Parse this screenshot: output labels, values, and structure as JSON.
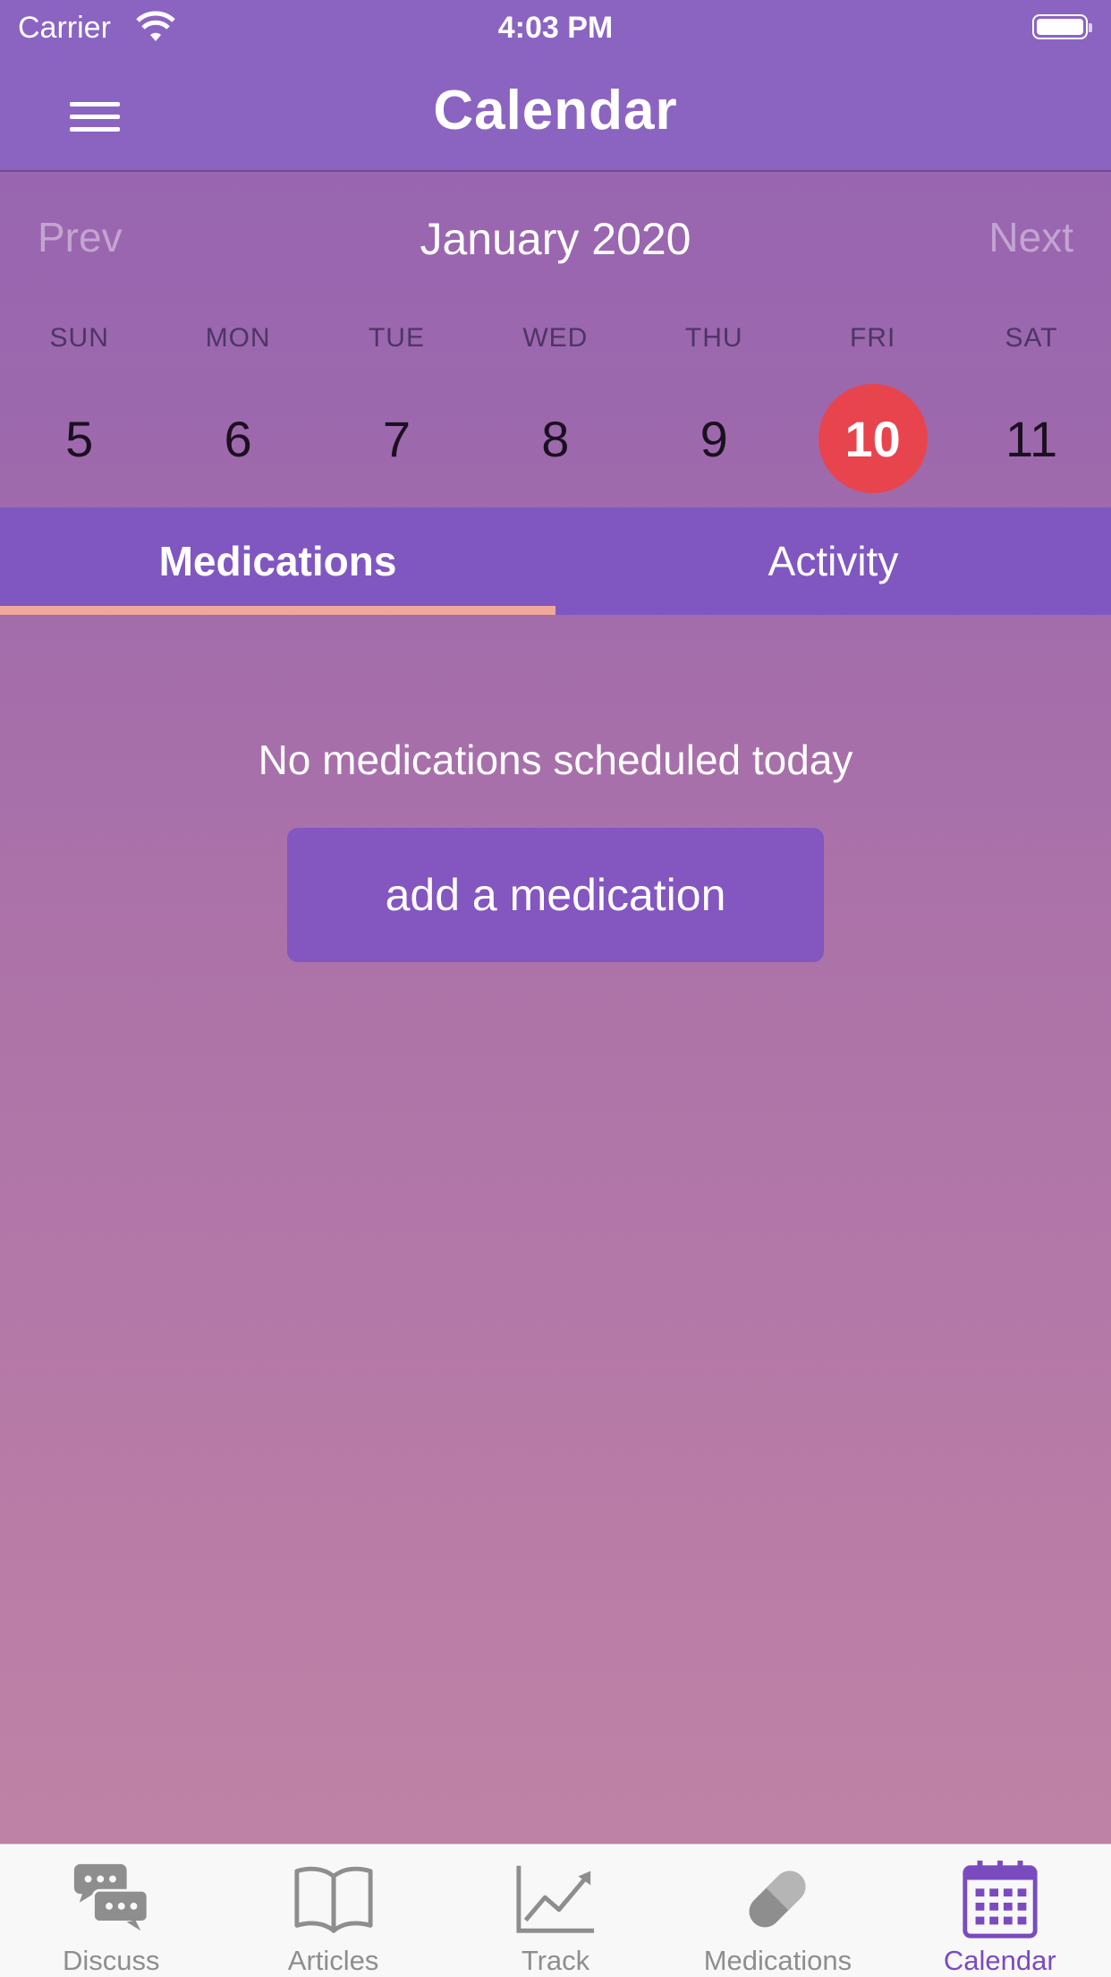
{
  "status_bar": {
    "carrier": "Carrier",
    "time": "4:03 PM"
  },
  "nav": {
    "title": "Calendar",
    "menu_icon": "hamburger-menu-icon"
  },
  "calendar": {
    "prev_label": "Prev",
    "next_label": "Next",
    "month_label": "January 2020",
    "weekdays": [
      "SUN",
      "MON",
      "TUE",
      "WED",
      "THU",
      "FRI",
      "SAT"
    ],
    "dates": [
      "5",
      "6",
      "7",
      "8",
      "9",
      "10",
      "11"
    ],
    "selected_index": 5,
    "selected_color": "#e8444d"
  },
  "tabs": [
    {
      "label": "Medications",
      "active": true
    },
    {
      "label": "Activity",
      "active": false
    }
  ],
  "content": {
    "empty_message": "No medications scheduled today",
    "add_button_label": "add a medication"
  },
  "bottom_tabs": [
    {
      "label": "Discuss",
      "icon": "chat-bubbles-icon",
      "active": false
    },
    {
      "label": "Articles",
      "icon": "open-book-icon",
      "active": false
    },
    {
      "label": "Track",
      "icon": "line-chart-icon",
      "active": false
    },
    {
      "label": "Medications",
      "icon": "pill-icon",
      "active": false
    },
    {
      "label": "Calendar",
      "icon": "calendar-icon",
      "active": true
    }
  ],
  "colors": {
    "accent": "#8057c0",
    "active_tab_underline": "#f0a89b",
    "active_bottom_tab": "#7a4bbf"
  }
}
